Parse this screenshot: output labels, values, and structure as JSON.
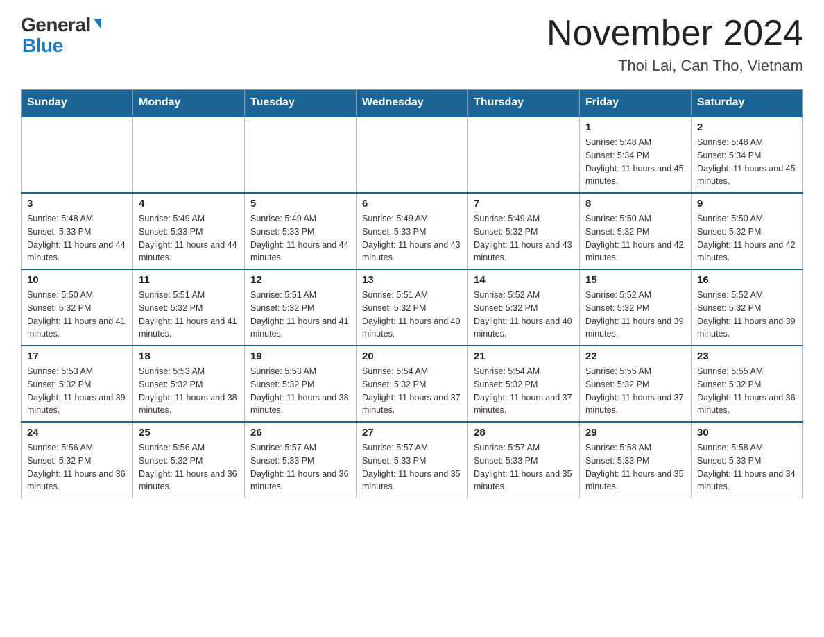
{
  "header": {
    "logo": {
      "general": "General",
      "blue": "Blue"
    },
    "title": "November 2024",
    "location": "Thoi Lai, Can Tho, Vietnam"
  },
  "weekdays": [
    "Sunday",
    "Monday",
    "Tuesday",
    "Wednesday",
    "Thursday",
    "Friday",
    "Saturday"
  ],
  "weeks": [
    [
      {
        "day": "",
        "info": ""
      },
      {
        "day": "",
        "info": ""
      },
      {
        "day": "",
        "info": ""
      },
      {
        "day": "",
        "info": ""
      },
      {
        "day": "",
        "info": ""
      },
      {
        "day": "1",
        "info": "Sunrise: 5:48 AM\nSunset: 5:34 PM\nDaylight: 11 hours and 45 minutes."
      },
      {
        "day": "2",
        "info": "Sunrise: 5:48 AM\nSunset: 5:34 PM\nDaylight: 11 hours and 45 minutes."
      }
    ],
    [
      {
        "day": "3",
        "info": "Sunrise: 5:48 AM\nSunset: 5:33 PM\nDaylight: 11 hours and 44 minutes."
      },
      {
        "day": "4",
        "info": "Sunrise: 5:49 AM\nSunset: 5:33 PM\nDaylight: 11 hours and 44 minutes."
      },
      {
        "day": "5",
        "info": "Sunrise: 5:49 AM\nSunset: 5:33 PM\nDaylight: 11 hours and 44 minutes."
      },
      {
        "day": "6",
        "info": "Sunrise: 5:49 AM\nSunset: 5:33 PM\nDaylight: 11 hours and 43 minutes."
      },
      {
        "day": "7",
        "info": "Sunrise: 5:49 AM\nSunset: 5:32 PM\nDaylight: 11 hours and 43 minutes."
      },
      {
        "day": "8",
        "info": "Sunrise: 5:50 AM\nSunset: 5:32 PM\nDaylight: 11 hours and 42 minutes."
      },
      {
        "day": "9",
        "info": "Sunrise: 5:50 AM\nSunset: 5:32 PM\nDaylight: 11 hours and 42 minutes."
      }
    ],
    [
      {
        "day": "10",
        "info": "Sunrise: 5:50 AM\nSunset: 5:32 PM\nDaylight: 11 hours and 41 minutes."
      },
      {
        "day": "11",
        "info": "Sunrise: 5:51 AM\nSunset: 5:32 PM\nDaylight: 11 hours and 41 minutes."
      },
      {
        "day": "12",
        "info": "Sunrise: 5:51 AM\nSunset: 5:32 PM\nDaylight: 11 hours and 41 minutes."
      },
      {
        "day": "13",
        "info": "Sunrise: 5:51 AM\nSunset: 5:32 PM\nDaylight: 11 hours and 40 minutes."
      },
      {
        "day": "14",
        "info": "Sunrise: 5:52 AM\nSunset: 5:32 PM\nDaylight: 11 hours and 40 minutes."
      },
      {
        "day": "15",
        "info": "Sunrise: 5:52 AM\nSunset: 5:32 PM\nDaylight: 11 hours and 39 minutes."
      },
      {
        "day": "16",
        "info": "Sunrise: 5:52 AM\nSunset: 5:32 PM\nDaylight: 11 hours and 39 minutes."
      }
    ],
    [
      {
        "day": "17",
        "info": "Sunrise: 5:53 AM\nSunset: 5:32 PM\nDaylight: 11 hours and 39 minutes."
      },
      {
        "day": "18",
        "info": "Sunrise: 5:53 AM\nSunset: 5:32 PM\nDaylight: 11 hours and 38 minutes."
      },
      {
        "day": "19",
        "info": "Sunrise: 5:53 AM\nSunset: 5:32 PM\nDaylight: 11 hours and 38 minutes."
      },
      {
        "day": "20",
        "info": "Sunrise: 5:54 AM\nSunset: 5:32 PM\nDaylight: 11 hours and 37 minutes."
      },
      {
        "day": "21",
        "info": "Sunrise: 5:54 AM\nSunset: 5:32 PM\nDaylight: 11 hours and 37 minutes."
      },
      {
        "day": "22",
        "info": "Sunrise: 5:55 AM\nSunset: 5:32 PM\nDaylight: 11 hours and 37 minutes."
      },
      {
        "day": "23",
        "info": "Sunrise: 5:55 AM\nSunset: 5:32 PM\nDaylight: 11 hours and 36 minutes."
      }
    ],
    [
      {
        "day": "24",
        "info": "Sunrise: 5:56 AM\nSunset: 5:32 PM\nDaylight: 11 hours and 36 minutes."
      },
      {
        "day": "25",
        "info": "Sunrise: 5:56 AM\nSunset: 5:32 PM\nDaylight: 11 hours and 36 minutes."
      },
      {
        "day": "26",
        "info": "Sunrise: 5:57 AM\nSunset: 5:33 PM\nDaylight: 11 hours and 36 minutes."
      },
      {
        "day": "27",
        "info": "Sunrise: 5:57 AM\nSunset: 5:33 PM\nDaylight: 11 hours and 35 minutes."
      },
      {
        "day": "28",
        "info": "Sunrise: 5:57 AM\nSunset: 5:33 PM\nDaylight: 11 hours and 35 minutes."
      },
      {
        "day": "29",
        "info": "Sunrise: 5:58 AM\nSunset: 5:33 PM\nDaylight: 11 hours and 35 minutes."
      },
      {
        "day": "30",
        "info": "Sunrise: 5:58 AM\nSunset: 5:33 PM\nDaylight: 11 hours and 34 minutes."
      }
    ]
  ]
}
